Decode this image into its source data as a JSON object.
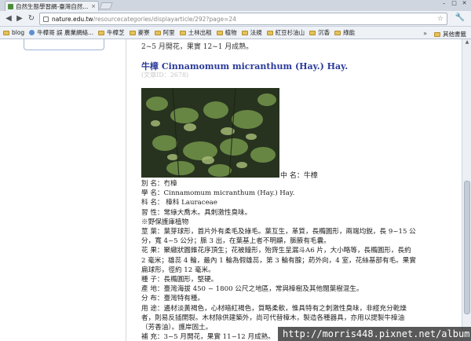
{
  "browser": {
    "tab_title": "自然生態學習網-臺灣自然...",
    "tab_close": "×",
    "url_host": "nature.edu.tw",
    "url_path": "/resourcecategories/displayarticle/292?page=24",
    "bookmarks": [
      {
        "label": "blog",
        "icon": "folder-icon"
      },
      {
        "label": "牛樟哥 誤 農業網絡...",
        "icon": "globe-icon"
      },
      {
        "label": "牛樟芝",
        "icon": "folder-icon"
      },
      {
        "label": "麥寮",
        "icon": "folder-icon"
      },
      {
        "label": "阿里",
        "icon": "folder-icon"
      },
      {
        "label": "土林出租",
        "icon": "folder-icon"
      },
      {
        "label": "植物",
        "icon": "folder-icon"
      },
      {
        "label": "法規",
        "icon": "folder-icon"
      },
      {
        "label": "紅豆杉油山",
        "icon": "folder-icon"
      },
      {
        "label": "沉香",
        "icon": "folder-icon"
      },
      {
        "label": "綠能",
        "icon": "folder-icon"
      }
    ],
    "bookmarks_more": "»",
    "other_bookmarks": "其他書籤"
  },
  "article": {
    "prev_line": "2~5 月開花，果實 12~1 月成熟。",
    "title": "牛樟 Cinnamomum micranthum (Hay.) Hay.",
    "views": "(文章ID：2678)",
    "cname_label": "中 名：牛樟",
    "lines": [
      "別 名：冇樟",
      "學 名：Cinnamomum micranthum (Hay.) Hay.",
      "科 名： 樟科 Lauraceae",
      "習 性：常綠大喬木。具刺激性臭味。",
      "※野保護庫植物",
      "莖 葉：葉芽球形，首片外有柔毛及綠毛。葉互生，革質，長橢圓形，兩端均銳，長 9~15 公",
      "分，寬 4~5 公分；脈 3 出，在葉基上者不明顯，脈腋有毛囊。",
      "花 果：聚繖狀圓錐花序頂生；花被鐘形，殆齊生呈漏斗A6 片，大小略等，長橢圓形，長約",
      "2 毫米；雄蕊 4 輪，最內 1 輪為假雄蕊，第 3 輪有腺；葯外向，4 室，花絲基部有毛。果實",
      "扁球形，徑約 12 毫米。",
      "種 子：長橢圓形，堅硬。",
      "產 地：臺灣海拔 450 ~ 1800 公尺之地區，常與樟樹及其他闊葉樹混生。",
      "分 布：臺灣特有種。",
      "用 途：邊材淡黃褐色，心材暗紅褐色，質略柔軟，惟具特有之刺激性臭味，非經充分乾燥",
      "者，則易反插開裂。木材除供建築外，尚可代替樟木，製造各種器具，亦用以提製牛樟油",
      "（芳香油）。護岸固土。",
      "補 充：3~5 月開花，果實 11~12 月成熟。"
    ]
  },
  "watermark": "http://morris448.pixnet.net/album",
  "colors": {
    "title": "#2a3a9a",
    "views": "#c8c8c8",
    "chrome": "#d9dfe8"
  }
}
